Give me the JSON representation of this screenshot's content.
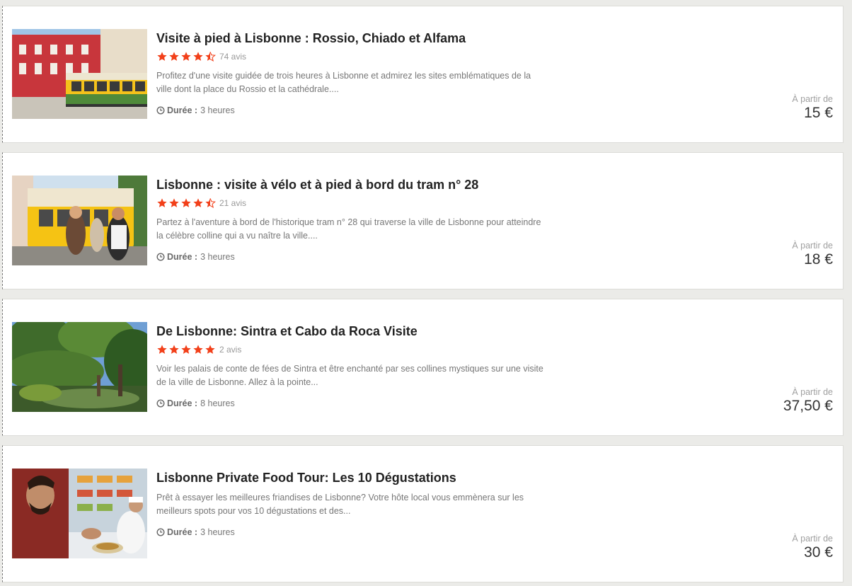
{
  "tours": [
    {
      "title": "Visite à pied à Lisbonne : Rossio, Chiado et Alfama",
      "rating": 4.5,
      "reviews": "74 avis",
      "description": "Profitez d'une visite guidée de trois heures à Lisbonne et admirez les sites emblématiques de la ville dont la place du Rossio et la cathédrale....",
      "duration_label": "Durée :",
      "duration": "3 heures",
      "price_from": "À partir de",
      "price": "15 €",
      "image": "lisbon-tram-red-building-photo"
    },
    {
      "title": "Lisbonne : visite à vélo et à pied à bord du tram n° 28",
      "rating": 4.5,
      "reviews": "21 avis",
      "description": "Partez à l'aventure à bord de l'historique tram n° 28 qui traverse la ville de Lisbonne pour atteindre la célèbre colline qui a vu naître la ville....",
      "duration_label": "Durée :",
      "duration": "3 heures",
      "price_from": "À partir de",
      "price": "18 €",
      "image": "tourists-boarding-tram-28-photo"
    },
    {
      "title": "De Lisbonne: Sintra et Cabo da Roca Visite",
      "rating": 5,
      "reviews": "2 avis",
      "description": "Voir les palais de conte de fées de Sintra et être enchanté par ses collines mystiques sur une visite de la ville de Lisbonne. Allez à la pointe...",
      "duration_label": "Durée :",
      "duration": "8 heures",
      "price_from": "À partir de",
      "price": "37,50 €",
      "image": "sintra-garden-pond-photo"
    },
    {
      "title": "Lisbonne Private Food Tour: Les 10 Dégustations",
      "rating": null,
      "reviews": null,
      "description": "Prêt à essayer les meilleures friandises de Lisbonne? Votre hôte local vous emmènera sur les meilleurs spots pour vos 10 dégustations et des...",
      "duration_label": "Durée :",
      "duration": "3 heures",
      "price_from": "À partir de",
      "price": "30 €",
      "image": "food-tasting-counter-photo"
    }
  ],
  "colors": {
    "star": "#f2401a",
    "page_bg": "#ebebe8",
    "card_bg": "#ffffff"
  }
}
